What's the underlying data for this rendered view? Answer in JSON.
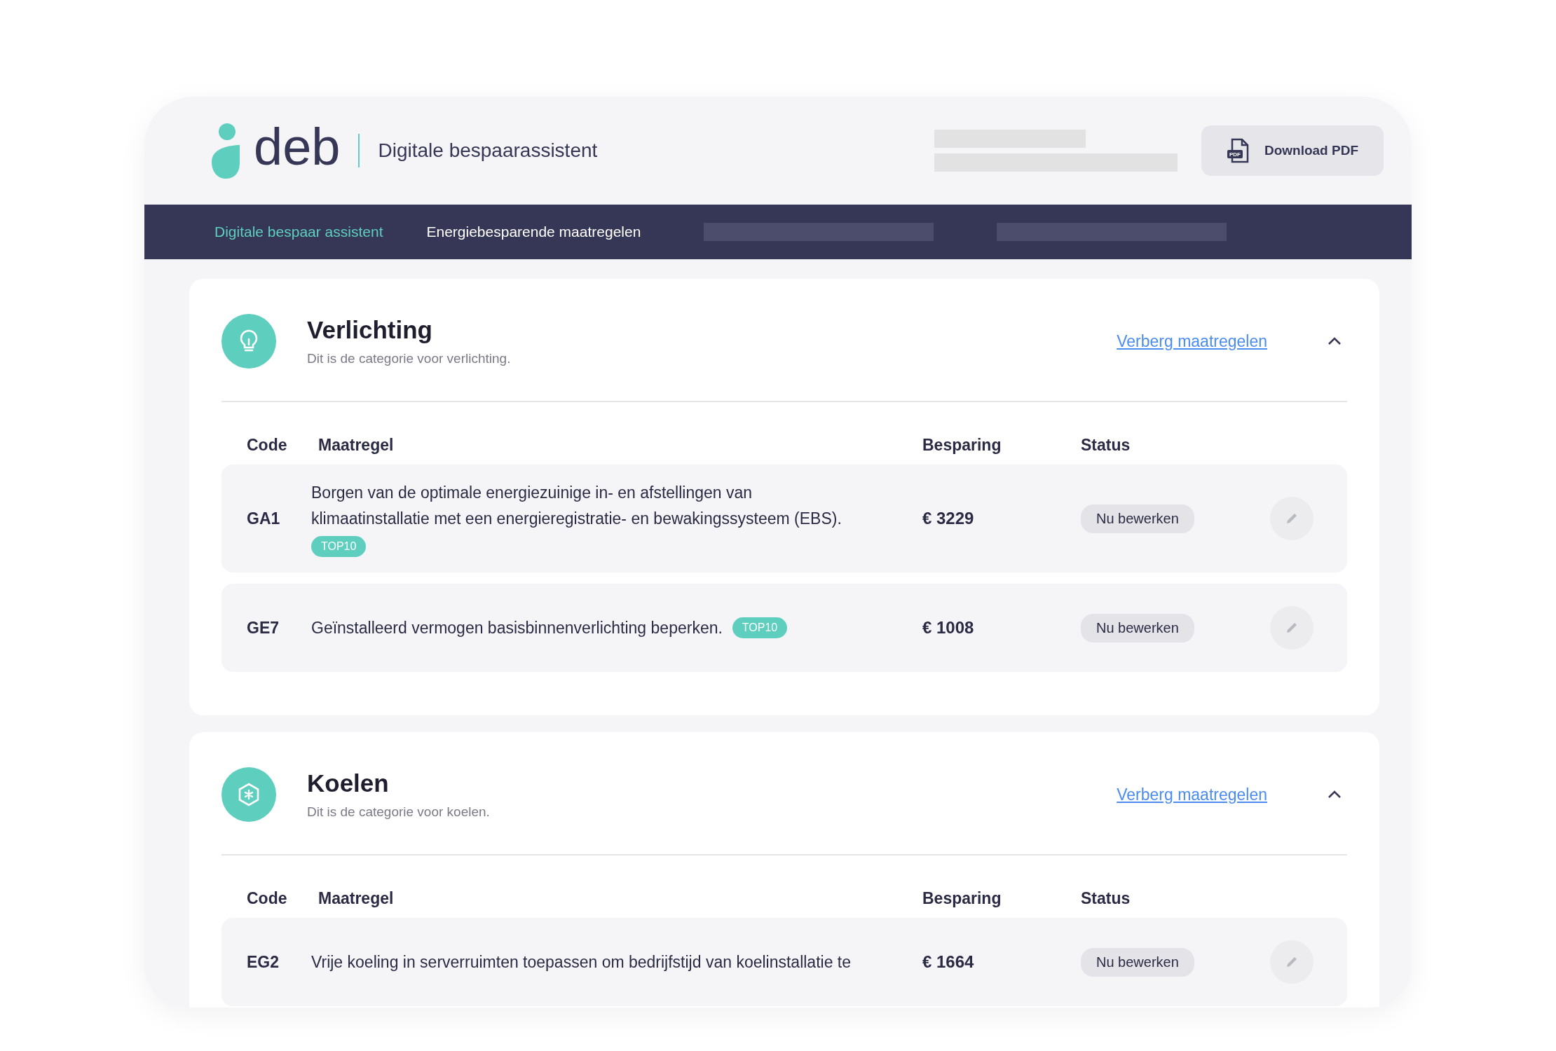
{
  "header": {
    "logo_text": "deb",
    "app_name": "Digitale bespaarassistent",
    "download_button": "Download PDF",
    "pdf_badge": "PDF"
  },
  "nav": {
    "items": [
      {
        "label": "Digitale bespaar assistent",
        "selected": true
      },
      {
        "label": "Energiebesparende maatregelen",
        "selected": false
      }
    ]
  },
  "categories": [
    {
      "kind": "light",
      "title": "Verlichting",
      "subtitle": "Dit is de categorie voor verlichting.",
      "toggle_link": "Verberg maatregelen",
      "expanded": true,
      "columns": [
        "Code",
        "Maatregel",
        "Besparing",
        "Status"
      ],
      "rows": [
        {
          "code": "GA1",
          "description": "Borgen van de optimale energiezuinige in- en afstellingen van klimaatinstallatie met een energieregistratie- en bewakingssysteem (EBS).",
          "badge": "TOP10",
          "saving": "€ 3229",
          "status": "Nu bewerken"
        },
        {
          "code": "GE7",
          "description": "Geïnstalleerd vermogen basisbinnenverlichting beperken.",
          "badge": "TOP10",
          "saving": "€ 1008",
          "status": "Nu bewerken"
        }
      ]
    },
    {
      "kind": "cold",
      "title": "Koelen",
      "subtitle": "Dit is de categorie voor koelen.",
      "toggle_link": "Verberg maatregelen",
      "expanded": true,
      "columns": [
        "Code",
        "Maatregel",
        "Besparing",
        "Status"
      ],
      "rows": [
        {
          "code": "EG2",
          "description": "Vrije koeling in serverruimten toepassen om bedrijfstijd van koelinstallatie te",
          "saving": "€ 1664",
          "status": "Nu bewerken"
        }
      ]
    }
  ]
}
